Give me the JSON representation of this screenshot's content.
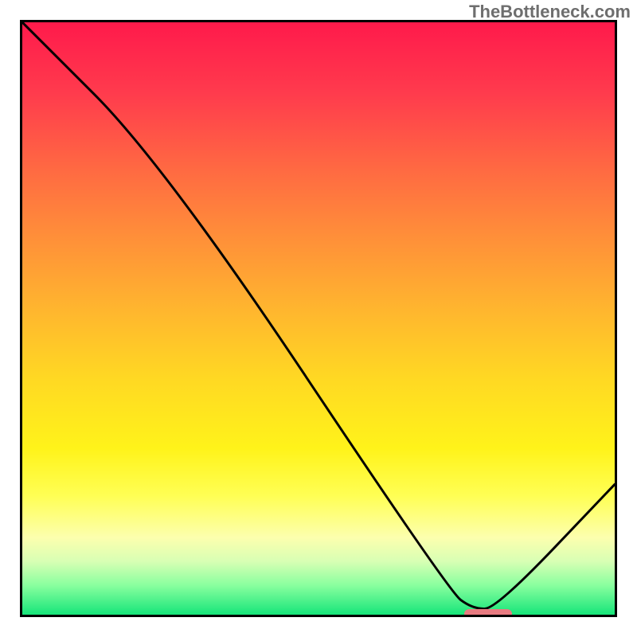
{
  "watermark": "TheBottleneck.com",
  "chart_data": {
    "type": "line",
    "title": "",
    "xlabel": "",
    "ylabel": "",
    "xlim": [
      0,
      100
    ],
    "ylim": [
      0,
      100
    ],
    "grid": false,
    "series": [
      {
        "name": "bottleneck-curve",
        "x": [
          0,
          24,
          72,
          76,
          80,
          100
        ],
        "y": [
          100,
          76,
          4,
          1,
          1,
          22
        ]
      }
    ],
    "annotations": [
      {
        "name": "optimal-marker",
        "x_start": 74,
        "x_end": 82,
        "y": 1,
        "color": "#e87b81"
      }
    ],
    "background_gradient": {
      "type": "vertical",
      "stops": [
        {
          "pos": 0,
          "color": "#ff1a4b"
        },
        {
          "pos": 12,
          "color": "#ff3b4d"
        },
        {
          "pos": 25,
          "color": "#ff6a42"
        },
        {
          "pos": 35,
          "color": "#ff8b3a"
        },
        {
          "pos": 48,
          "color": "#ffb42f"
        },
        {
          "pos": 60,
          "color": "#ffd823"
        },
        {
          "pos": 72,
          "color": "#fff31a"
        },
        {
          "pos": 80,
          "color": "#ffff55"
        },
        {
          "pos": 87,
          "color": "#fcffae"
        },
        {
          "pos": 91,
          "color": "#d8ffb4"
        },
        {
          "pos": 95,
          "color": "#8aff9f"
        },
        {
          "pos": 100,
          "color": "#16e57a"
        }
      ]
    }
  }
}
